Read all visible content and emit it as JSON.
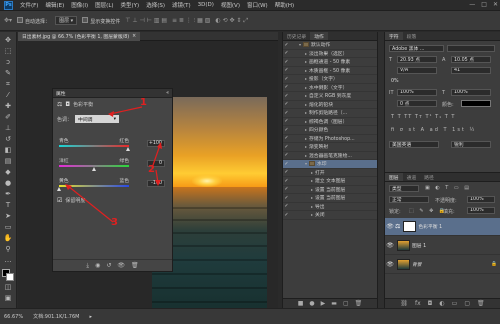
{
  "app": {
    "logo": "Ps"
  },
  "menu": [
    "文件(F)",
    "编辑(E)",
    "图像(I)",
    "图层(L)",
    "类型(Y)",
    "选择(S)",
    "滤镜(T)",
    "3D(D)",
    "视图(V)",
    "窗口(W)",
    "帮助(H)"
  ],
  "window_controls": [
    "—",
    "□",
    "✕"
  ],
  "options_bar": {
    "auto_select_label": "自动选择：",
    "auto_select_value": "图层",
    "show_transform_label": "显示变换控件"
  },
  "document_tab": {
    "title": "日出素材.jpg @ 66.7% (色彩平衡 1, 图层蒙版/8)",
    "close": "×"
  },
  "properties": {
    "title": "属性",
    "collapse": "«",
    "panel_name": "色彩平衡",
    "tone_label": "色调：",
    "tone_value": "中间调",
    "sliders": [
      {
        "left": "青色",
        "right": "红色",
        "value": "+100"
      },
      {
        "left": "洋红",
        "right": "绿色",
        "value": "0"
      },
      {
        "left": "黄色",
        "right": "蓝色",
        "value": "-100"
      }
    ],
    "preserve_luminosity": "保留明度"
  },
  "annotations": [
    "1",
    "2",
    "3"
  ],
  "actions": {
    "tabs": [
      "历史记录",
      "动作"
    ],
    "items": [
      {
        "label": "默认动作",
        "level": 0,
        "folder": true
      },
      {
        "label": "淡出效果（选区）",
        "level": 1
      },
      {
        "label": "画框通道 - 50 像素",
        "level": 1
      },
      {
        "label": "木质画框 - 50 像素",
        "level": 1
      },
      {
        "label": "投影（文字）",
        "level": 1
      },
      {
        "label": "水中倒影（文字）",
        "level": 1
      },
      {
        "label": "自定义 RGB 到灰度",
        "level": 1
      },
      {
        "label": "熔化的铅块",
        "level": 1
      },
      {
        "label": "制作剪贴路径（...",
        "level": 1
      },
      {
        "label": "棕褐色调（图层）",
        "level": 1
      },
      {
        "label": "四分颜色",
        "level": 1
      },
      {
        "label": "存储为 Photoshop...",
        "level": 1
      },
      {
        "label": "渐变映射",
        "level": 1
      },
      {
        "label": "混合器画笔克隆绘...",
        "level": 1
      },
      {
        "label": "水印",
        "level": 1,
        "folder": true,
        "selected": true
      },
      {
        "label": "打开",
        "level": 2
      },
      {
        "label": "建立 文本图层",
        "level": 2
      },
      {
        "label": "设置 当前图层",
        "level": 2
      },
      {
        "label": "设置 当前图层",
        "level": 2
      },
      {
        "label": "导出",
        "level": 2
      },
      {
        "label": "关闭",
        "level": 2
      }
    ]
  },
  "character": {
    "tabs": [
      "字符",
      "段落"
    ],
    "font": "Adobe 黑体 ...",
    "size": "20.93 点",
    "leading": "10.05 点",
    "tracking_metric": "V/A",
    "tracking_value": "41",
    "vscale": "100%",
    "hscale": "100%",
    "baseline": "0 点",
    "aa_label": "锐利",
    "lang": "美国英语"
  },
  "layers": {
    "tabs": [
      "图层",
      "通道",
      "路径"
    ],
    "kind": "类型",
    "blend": "正常",
    "opacity_label": "不透明度:",
    "opacity": "100%",
    "lock_label": "锁定:",
    "fill_label": "填充:",
    "fill": "100%",
    "items": [
      {
        "name": "色彩平衡 1",
        "selected": true
      },
      {
        "name": "图层 1",
        "selected": false
      },
      {
        "name": "背景",
        "selected": false
      }
    ]
  },
  "status": {
    "zoom": "66.67%",
    "doc": "文档:901.1K/1.76M"
  }
}
